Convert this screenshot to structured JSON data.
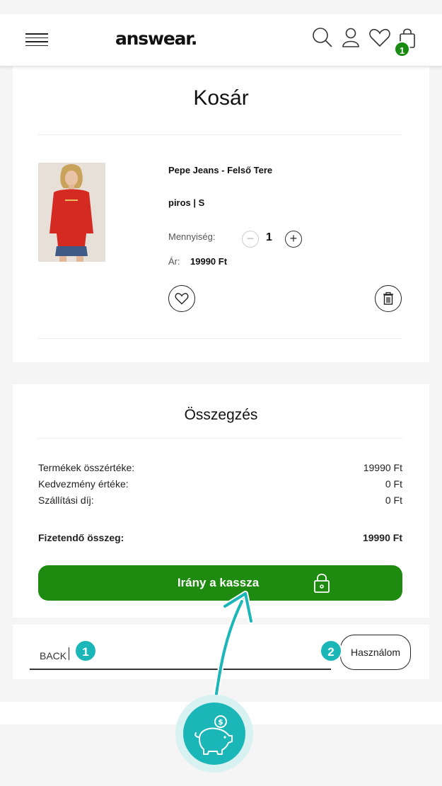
{
  "header": {
    "logo": "answear.",
    "cart_count": "1"
  },
  "cart": {
    "title": "Kosár",
    "product": {
      "name": "Pepe Jeans - Felső Tere",
      "variant": "piros | S",
      "quantity_label": "Mennyiség:",
      "minus": "−",
      "quantity": "1",
      "plus": "+",
      "price_label": "Ár:",
      "price": "19990 Ft",
      "shirt_color": "#d42a22"
    }
  },
  "summary": {
    "title": "Összegzés",
    "rows": [
      {
        "label": "Termékek összértéke:",
        "value": "19990 Ft"
      },
      {
        "label": "Kedvezmény értéke:",
        "value": "0 Ft"
      },
      {
        "label": "Szállítási díj:",
        "value": "0 Ft"
      }
    ],
    "total_label": "Fizetendő összeg:",
    "total_value": "19990 Ft",
    "checkout_label": "Irány a kassza"
  },
  "coupon": {
    "input_value": "BACK",
    "button_label": "Használom"
  },
  "guides": {
    "step_1": "1",
    "step_2": "2",
    "accent_color": "#1ab6b8"
  },
  "colors": {
    "brand_green": "#1e8a0f",
    "badge_green": "#1b8a12"
  }
}
